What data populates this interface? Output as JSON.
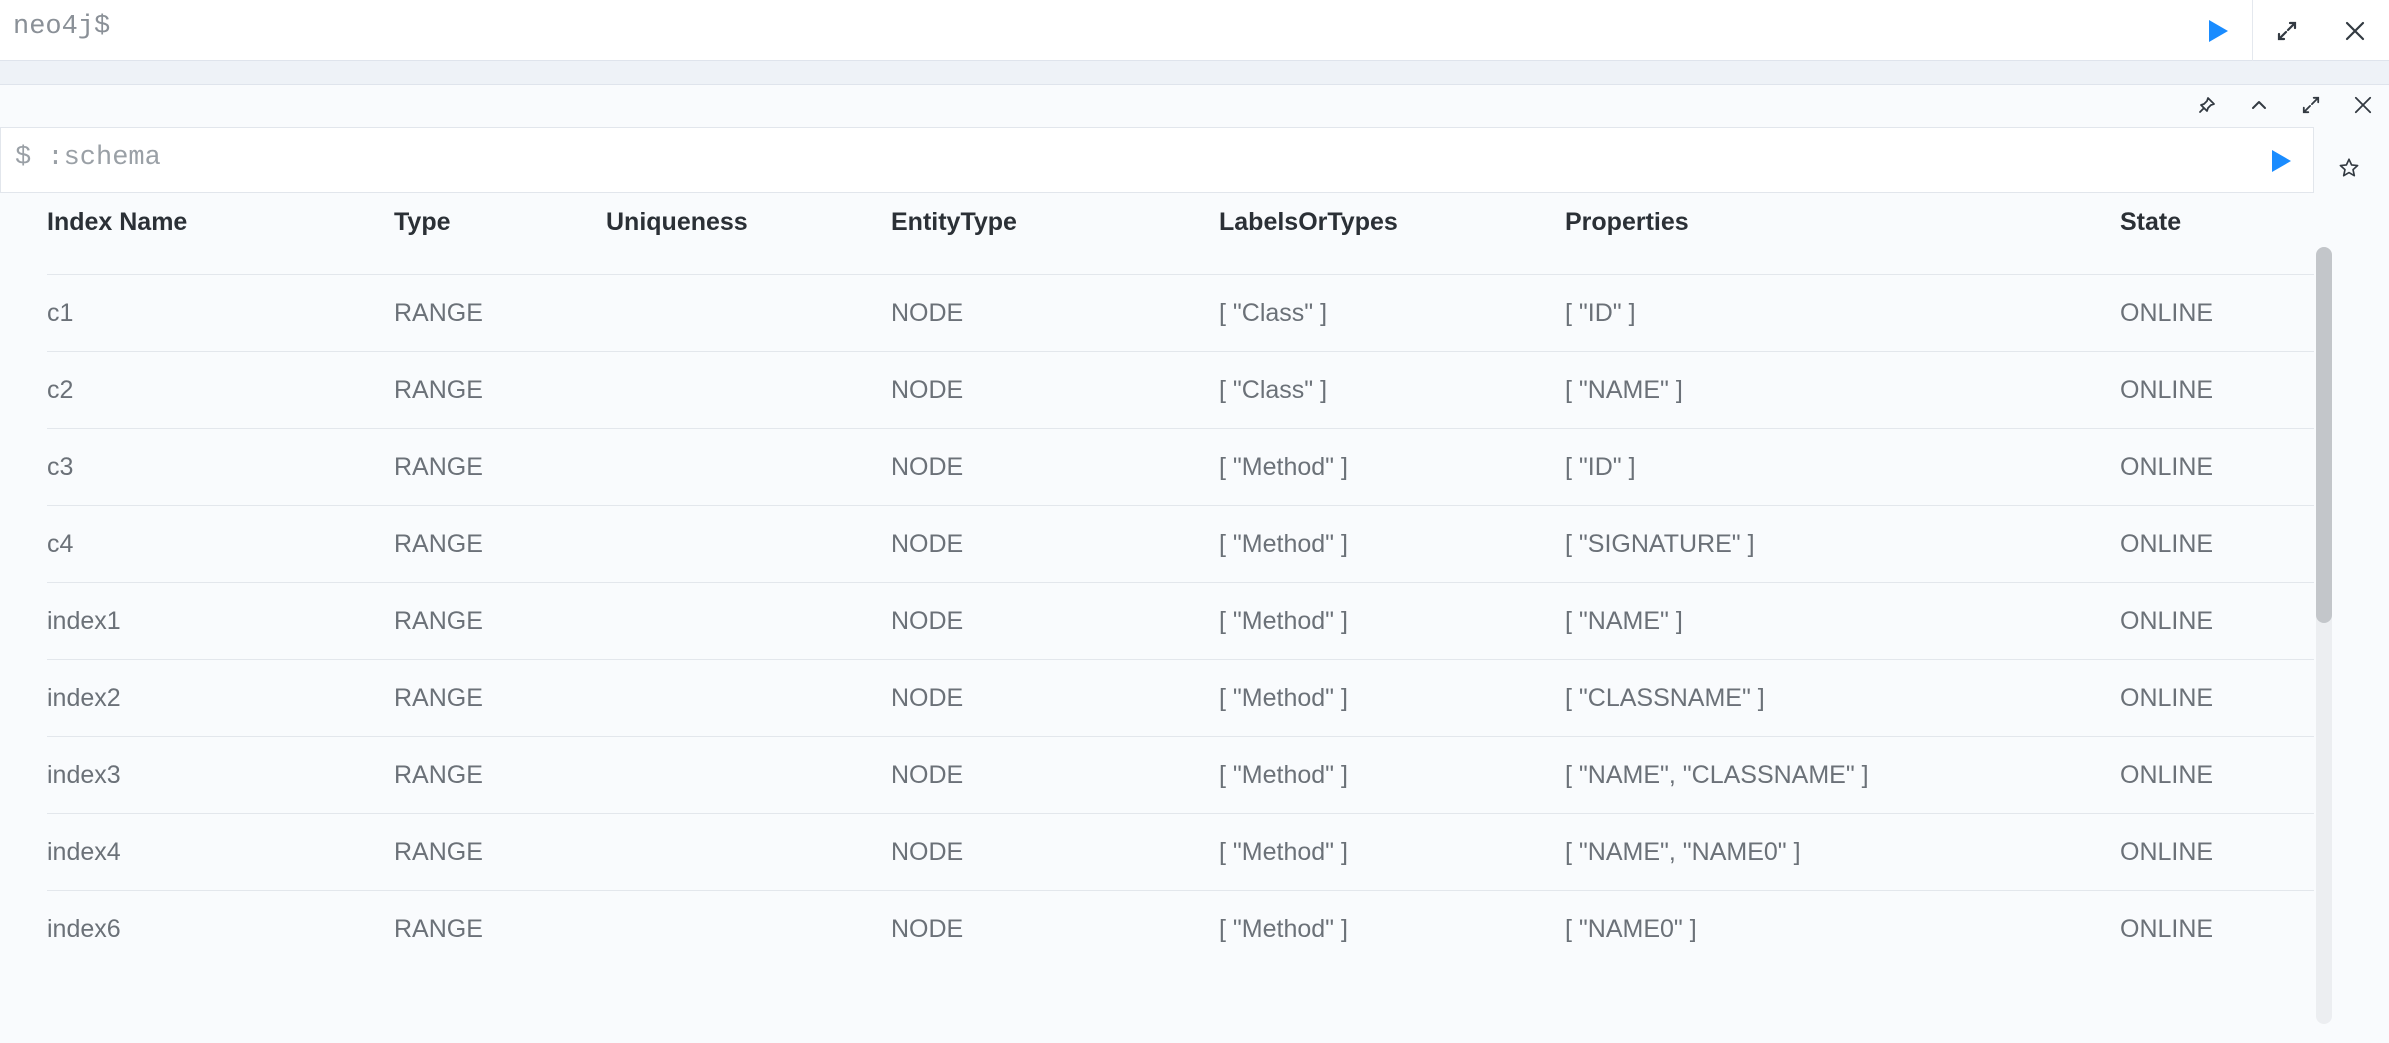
{
  "topbar": {
    "prompt": "neo4j$"
  },
  "editor": {
    "prefix": "$",
    "query": ":schema"
  },
  "table": {
    "headers": [
      "Index Name",
      "Type",
      "Uniqueness",
      "EntityType",
      "LabelsOrTypes",
      "Properties",
      "State"
    ],
    "rows": [
      [
        "c1",
        "RANGE",
        "",
        "NODE",
        "[ \"Class\" ]",
        "[ \"ID\" ]",
        "ONLINE"
      ],
      [
        "c2",
        "RANGE",
        "",
        "NODE",
        "[ \"Class\" ]",
        "[ \"NAME\" ]",
        "ONLINE"
      ],
      [
        "c3",
        "RANGE",
        "",
        "NODE",
        "[ \"Method\" ]",
        "[ \"ID\" ]",
        "ONLINE"
      ],
      [
        "c4",
        "RANGE",
        "",
        "NODE",
        "[ \"Method\" ]",
        "[ \"SIGNATURE\" ]",
        "ONLINE"
      ],
      [
        "index1",
        "RANGE",
        "",
        "NODE",
        "[ \"Method\" ]",
        "[ \"NAME\" ]",
        "ONLINE"
      ],
      [
        "index2",
        "RANGE",
        "",
        "NODE",
        "[ \"Method\" ]",
        "[ \"CLASSNAME\" ]",
        "ONLINE"
      ],
      [
        "index3",
        "RANGE",
        "",
        "NODE",
        "[ \"Method\" ]",
        "[ \"NAME\", \"CLASSNAME\" ]",
        "ONLINE"
      ],
      [
        "index4",
        "RANGE",
        "",
        "NODE",
        "[ \"Method\" ]",
        "[ \"NAME\", \"NAME0\" ]",
        "ONLINE"
      ],
      [
        "index6",
        "RANGE",
        "",
        "NODE",
        "[ \"Method\" ]",
        "[ \"NAME0\" ]",
        "ONLINE"
      ]
    ]
  },
  "icons": {
    "run": "play-icon",
    "expand": "expand-icon",
    "close": "close-icon",
    "pin": "pin-icon",
    "collapse": "chevron-up-icon",
    "favorite": "star-icon"
  },
  "colors": {
    "accent": "#1a8cff",
    "icon": "#333a42"
  }
}
